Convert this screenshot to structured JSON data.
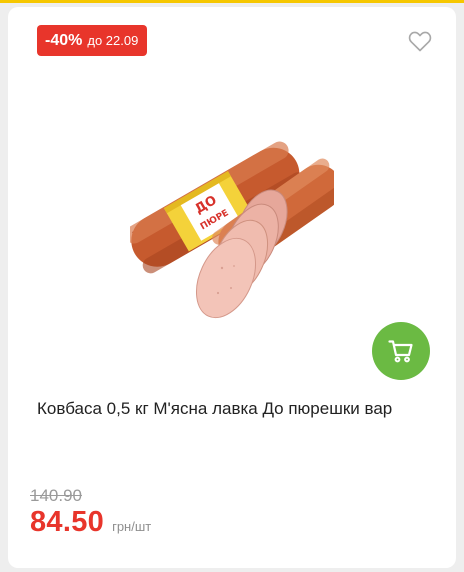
{
  "badge": {
    "discount": "-40%",
    "until": "до 22.09"
  },
  "product": {
    "title": "Ковбаса 0,5 кг М'ясна лавка До пюрешки вар",
    "image_alt": "Ковбаса 0,5 кг М'ясна лавка До пюрешки вар",
    "image_label_text": "До пюрешки"
  },
  "price": {
    "old": "140.90",
    "current": "84.50",
    "unit": "грн/шт"
  },
  "icons": {
    "favorite": "heart-outline-icon",
    "cart": "shopping-cart-icon"
  },
  "colors": {
    "accent_red": "#e8352b",
    "cart_green": "#6bba43",
    "top_stripe": "#f6c700"
  }
}
